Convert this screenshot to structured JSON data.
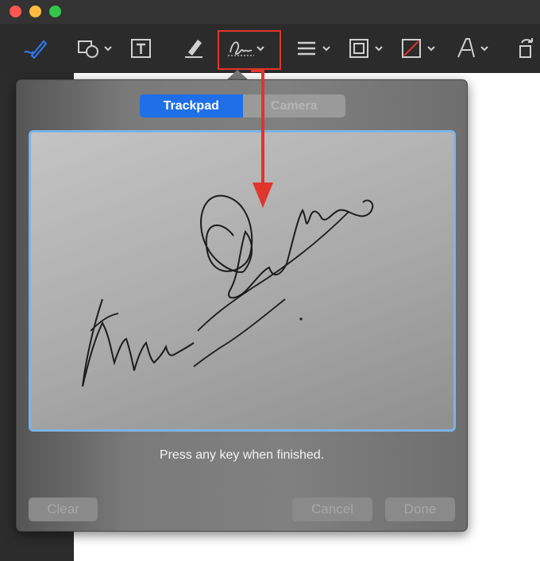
{
  "window": {
    "controls": [
      "close",
      "minimize",
      "zoom"
    ]
  },
  "toolbar": {
    "tools": [
      {
        "name": "sketch-icon"
      },
      {
        "name": "shapes-icon"
      },
      {
        "name": "text-box-icon"
      },
      {
        "name": "highlight-icon"
      },
      {
        "name": "signature-icon"
      },
      {
        "name": "line-style-icon"
      },
      {
        "name": "border-color-icon"
      },
      {
        "name": "fill-color-icon"
      },
      {
        "name": "text-style-icon"
      },
      {
        "name": "rotate-icon"
      }
    ],
    "accent": "#2f7bf6"
  },
  "signature_panel": {
    "tabs": {
      "trackpad": "Trackpad",
      "camera": "Camera"
    },
    "active_tab": "trackpad",
    "instruction": "Press any key when finished.",
    "buttons": {
      "clear": "Clear",
      "cancel": "Cancel",
      "done": "Done"
    },
    "active_tab_color": "#1e6fe8",
    "pad_border_color": "#7eb3e5"
  },
  "annotation": {
    "highlight_color": "#e0352b"
  }
}
